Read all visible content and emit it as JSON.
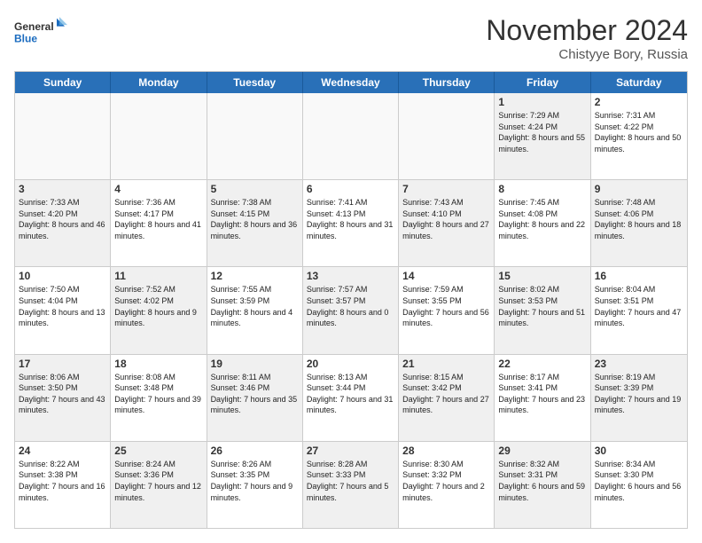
{
  "header": {
    "logo_general": "General",
    "logo_blue": "Blue",
    "month_title": "November 2024",
    "location": "Chistyye Bory, Russia"
  },
  "days_of_week": [
    "Sunday",
    "Monday",
    "Tuesday",
    "Wednesday",
    "Thursday",
    "Friday",
    "Saturday"
  ],
  "weeks": [
    [
      {
        "day": "",
        "info": "",
        "empty": true
      },
      {
        "day": "",
        "info": "",
        "empty": true
      },
      {
        "day": "",
        "info": "",
        "empty": true
      },
      {
        "day": "",
        "info": "",
        "empty": true
      },
      {
        "day": "",
        "info": "",
        "empty": true
      },
      {
        "day": "1",
        "info": "Sunrise: 7:29 AM\nSunset: 4:24 PM\nDaylight: 8 hours and 55 minutes.",
        "shaded": true
      },
      {
        "day": "2",
        "info": "Sunrise: 7:31 AM\nSunset: 4:22 PM\nDaylight: 8 hours and 50 minutes.",
        "shaded": false
      }
    ],
    [
      {
        "day": "3",
        "info": "Sunrise: 7:33 AM\nSunset: 4:20 PM\nDaylight: 8 hours and 46 minutes.",
        "shaded": true
      },
      {
        "day": "4",
        "info": "Sunrise: 7:36 AM\nSunset: 4:17 PM\nDaylight: 8 hours and 41 minutes.",
        "shaded": false
      },
      {
        "day": "5",
        "info": "Sunrise: 7:38 AM\nSunset: 4:15 PM\nDaylight: 8 hours and 36 minutes.",
        "shaded": true
      },
      {
        "day": "6",
        "info": "Sunrise: 7:41 AM\nSunset: 4:13 PM\nDaylight: 8 hours and 31 minutes.",
        "shaded": false
      },
      {
        "day": "7",
        "info": "Sunrise: 7:43 AM\nSunset: 4:10 PM\nDaylight: 8 hours and 27 minutes.",
        "shaded": true
      },
      {
        "day": "8",
        "info": "Sunrise: 7:45 AM\nSunset: 4:08 PM\nDaylight: 8 hours and 22 minutes.",
        "shaded": false
      },
      {
        "day": "9",
        "info": "Sunrise: 7:48 AM\nSunset: 4:06 PM\nDaylight: 8 hours and 18 minutes.",
        "shaded": true
      }
    ],
    [
      {
        "day": "10",
        "info": "Sunrise: 7:50 AM\nSunset: 4:04 PM\nDaylight: 8 hours and 13 minutes.",
        "shaded": false
      },
      {
        "day": "11",
        "info": "Sunrise: 7:52 AM\nSunset: 4:02 PM\nDaylight: 8 hours and 9 minutes.",
        "shaded": true
      },
      {
        "day": "12",
        "info": "Sunrise: 7:55 AM\nSunset: 3:59 PM\nDaylight: 8 hours and 4 minutes.",
        "shaded": false
      },
      {
        "day": "13",
        "info": "Sunrise: 7:57 AM\nSunset: 3:57 PM\nDaylight: 8 hours and 0 minutes.",
        "shaded": true
      },
      {
        "day": "14",
        "info": "Sunrise: 7:59 AM\nSunset: 3:55 PM\nDaylight: 7 hours and 56 minutes.",
        "shaded": false
      },
      {
        "day": "15",
        "info": "Sunrise: 8:02 AM\nSunset: 3:53 PM\nDaylight: 7 hours and 51 minutes.",
        "shaded": true
      },
      {
        "day": "16",
        "info": "Sunrise: 8:04 AM\nSunset: 3:51 PM\nDaylight: 7 hours and 47 minutes.",
        "shaded": false
      }
    ],
    [
      {
        "day": "17",
        "info": "Sunrise: 8:06 AM\nSunset: 3:50 PM\nDaylight: 7 hours and 43 minutes.",
        "shaded": true
      },
      {
        "day": "18",
        "info": "Sunrise: 8:08 AM\nSunset: 3:48 PM\nDaylight: 7 hours and 39 minutes.",
        "shaded": false
      },
      {
        "day": "19",
        "info": "Sunrise: 8:11 AM\nSunset: 3:46 PM\nDaylight: 7 hours and 35 minutes.",
        "shaded": true
      },
      {
        "day": "20",
        "info": "Sunrise: 8:13 AM\nSunset: 3:44 PM\nDaylight: 7 hours and 31 minutes.",
        "shaded": false
      },
      {
        "day": "21",
        "info": "Sunrise: 8:15 AM\nSunset: 3:42 PM\nDaylight: 7 hours and 27 minutes.",
        "shaded": true
      },
      {
        "day": "22",
        "info": "Sunrise: 8:17 AM\nSunset: 3:41 PM\nDaylight: 7 hours and 23 minutes.",
        "shaded": false
      },
      {
        "day": "23",
        "info": "Sunrise: 8:19 AM\nSunset: 3:39 PM\nDaylight: 7 hours and 19 minutes.",
        "shaded": true
      }
    ],
    [
      {
        "day": "24",
        "info": "Sunrise: 8:22 AM\nSunset: 3:38 PM\nDaylight: 7 hours and 16 minutes.",
        "shaded": false
      },
      {
        "day": "25",
        "info": "Sunrise: 8:24 AM\nSunset: 3:36 PM\nDaylight: 7 hours and 12 minutes.",
        "shaded": true
      },
      {
        "day": "26",
        "info": "Sunrise: 8:26 AM\nSunset: 3:35 PM\nDaylight: 7 hours and 9 minutes.",
        "shaded": false
      },
      {
        "day": "27",
        "info": "Sunrise: 8:28 AM\nSunset: 3:33 PM\nDaylight: 7 hours and 5 minutes.",
        "shaded": true
      },
      {
        "day": "28",
        "info": "Sunrise: 8:30 AM\nSunset: 3:32 PM\nDaylight: 7 hours and 2 minutes.",
        "shaded": false
      },
      {
        "day": "29",
        "info": "Sunrise: 8:32 AM\nSunset: 3:31 PM\nDaylight: 6 hours and 59 minutes.",
        "shaded": true
      },
      {
        "day": "30",
        "info": "Sunrise: 8:34 AM\nSunset: 3:30 PM\nDaylight: 6 hours and 56 minutes.",
        "shaded": false
      }
    ]
  ]
}
